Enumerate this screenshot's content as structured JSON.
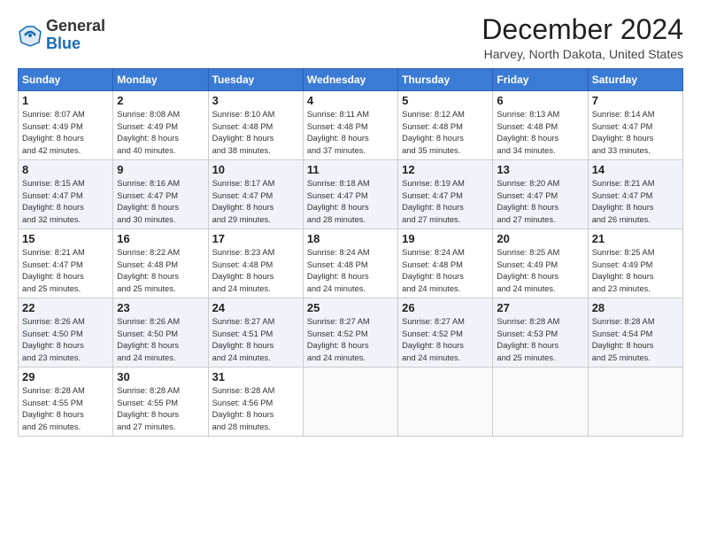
{
  "header": {
    "logo_general": "General",
    "logo_blue": "Blue",
    "title": "December 2024",
    "subtitle": "Harvey, North Dakota, United States"
  },
  "weekdays": [
    "Sunday",
    "Monday",
    "Tuesday",
    "Wednesday",
    "Thursday",
    "Friday",
    "Saturday"
  ],
  "weeks": [
    [
      {
        "day": "1",
        "lines": [
          "Sunrise: 8:07 AM",
          "Sunset: 4:49 PM",
          "Daylight: 8 hours",
          "and 42 minutes."
        ]
      },
      {
        "day": "2",
        "lines": [
          "Sunrise: 8:08 AM",
          "Sunset: 4:49 PM",
          "Daylight: 8 hours",
          "and 40 minutes."
        ]
      },
      {
        "day": "3",
        "lines": [
          "Sunrise: 8:10 AM",
          "Sunset: 4:48 PM",
          "Daylight: 8 hours",
          "and 38 minutes."
        ]
      },
      {
        "day": "4",
        "lines": [
          "Sunrise: 8:11 AM",
          "Sunset: 4:48 PM",
          "Daylight: 8 hours",
          "and 37 minutes."
        ]
      },
      {
        "day": "5",
        "lines": [
          "Sunrise: 8:12 AM",
          "Sunset: 4:48 PM",
          "Daylight: 8 hours",
          "and 35 minutes."
        ]
      },
      {
        "day": "6",
        "lines": [
          "Sunrise: 8:13 AM",
          "Sunset: 4:48 PM",
          "Daylight: 8 hours",
          "and 34 minutes."
        ]
      },
      {
        "day": "7",
        "lines": [
          "Sunrise: 8:14 AM",
          "Sunset: 4:47 PM",
          "Daylight: 8 hours",
          "and 33 minutes."
        ]
      }
    ],
    [
      {
        "day": "8",
        "lines": [
          "Sunrise: 8:15 AM",
          "Sunset: 4:47 PM",
          "Daylight: 8 hours",
          "and 32 minutes."
        ]
      },
      {
        "day": "9",
        "lines": [
          "Sunrise: 8:16 AM",
          "Sunset: 4:47 PM",
          "Daylight: 8 hours",
          "and 30 minutes."
        ]
      },
      {
        "day": "10",
        "lines": [
          "Sunrise: 8:17 AM",
          "Sunset: 4:47 PM",
          "Daylight: 8 hours",
          "and 29 minutes."
        ]
      },
      {
        "day": "11",
        "lines": [
          "Sunrise: 8:18 AM",
          "Sunset: 4:47 PM",
          "Daylight: 8 hours",
          "and 28 minutes."
        ]
      },
      {
        "day": "12",
        "lines": [
          "Sunrise: 8:19 AM",
          "Sunset: 4:47 PM",
          "Daylight: 8 hours",
          "and 27 minutes."
        ]
      },
      {
        "day": "13",
        "lines": [
          "Sunrise: 8:20 AM",
          "Sunset: 4:47 PM",
          "Daylight: 8 hours",
          "and 27 minutes."
        ]
      },
      {
        "day": "14",
        "lines": [
          "Sunrise: 8:21 AM",
          "Sunset: 4:47 PM",
          "Daylight: 8 hours",
          "and 26 minutes."
        ]
      }
    ],
    [
      {
        "day": "15",
        "lines": [
          "Sunrise: 8:21 AM",
          "Sunset: 4:47 PM",
          "Daylight: 8 hours",
          "and 25 minutes."
        ]
      },
      {
        "day": "16",
        "lines": [
          "Sunrise: 8:22 AM",
          "Sunset: 4:48 PM",
          "Daylight: 8 hours",
          "and 25 minutes."
        ]
      },
      {
        "day": "17",
        "lines": [
          "Sunrise: 8:23 AM",
          "Sunset: 4:48 PM",
          "Daylight: 8 hours",
          "and 24 minutes."
        ]
      },
      {
        "day": "18",
        "lines": [
          "Sunrise: 8:24 AM",
          "Sunset: 4:48 PM",
          "Daylight: 8 hours",
          "and 24 minutes."
        ]
      },
      {
        "day": "19",
        "lines": [
          "Sunrise: 8:24 AM",
          "Sunset: 4:48 PM",
          "Daylight: 8 hours",
          "and 24 minutes."
        ]
      },
      {
        "day": "20",
        "lines": [
          "Sunrise: 8:25 AM",
          "Sunset: 4:49 PM",
          "Daylight: 8 hours",
          "and 24 minutes."
        ]
      },
      {
        "day": "21",
        "lines": [
          "Sunrise: 8:25 AM",
          "Sunset: 4:49 PM",
          "Daylight: 8 hours",
          "and 23 minutes."
        ]
      }
    ],
    [
      {
        "day": "22",
        "lines": [
          "Sunrise: 8:26 AM",
          "Sunset: 4:50 PM",
          "Daylight: 8 hours",
          "and 23 minutes."
        ]
      },
      {
        "day": "23",
        "lines": [
          "Sunrise: 8:26 AM",
          "Sunset: 4:50 PM",
          "Daylight: 8 hours",
          "and 24 minutes."
        ]
      },
      {
        "day": "24",
        "lines": [
          "Sunrise: 8:27 AM",
          "Sunset: 4:51 PM",
          "Daylight: 8 hours",
          "and 24 minutes."
        ]
      },
      {
        "day": "25",
        "lines": [
          "Sunrise: 8:27 AM",
          "Sunset: 4:52 PM",
          "Daylight: 8 hours",
          "and 24 minutes."
        ]
      },
      {
        "day": "26",
        "lines": [
          "Sunrise: 8:27 AM",
          "Sunset: 4:52 PM",
          "Daylight: 8 hours",
          "and 24 minutes."
        ]
      },
      {
        "day": "27",
        "lines": [
          "Sunrise: 8:28 AM",
          "Sunset: 4:53 PM",
          "Daylight: 8 hours",
          "and 25 minutes."
        ]
      },
      {
        "day": "28",
        "lines": [
          "Sunrise: 8:28 AM",
          "Sunset: 4:54 PM",
          "Daylight: 8 hours",
          "and 25 minutes."
        ]
      }
    ],
    [
      {
        "day": "29",
        "lines": [
          "Sunrise: 8:28 AM",
          "Sunset: 4:55 PM",
          "Daylight: 8 hours",
          "and 26 minutes."
        ]
      },
      {
        "day": "30",
        "lines": [
          "Sunrise: 8:28 AM",
          "Sunset: 4:55 PM",
          "Daylight: 8 hours",
          "and 27 minutes."
        ]
      },
      {
        "day": "31",
        "lines": [
          "Sunrise: 8:28 AM",
          "Sunset: 4:56 PM",
          "Daylight: 8 hours",
          "and 28 minutes."
        ]
      },
      null,
      null,
      null,
      null
    ]
  ]
}
